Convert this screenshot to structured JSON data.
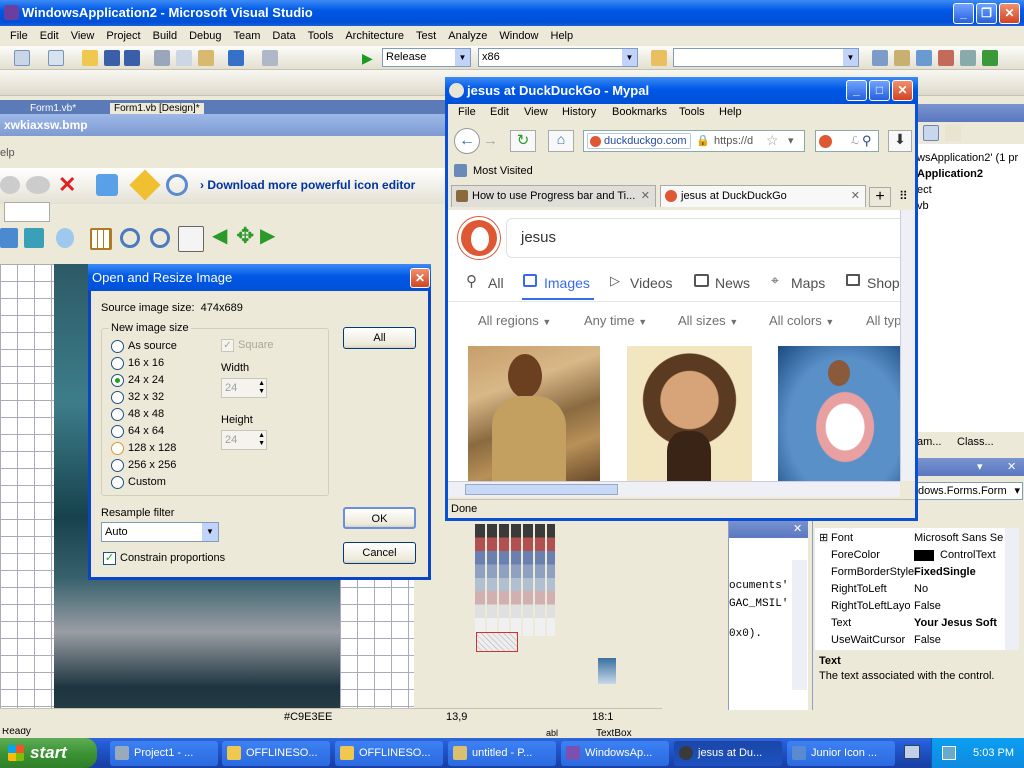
{
  "vs": {
    "title": "WindowsApplication2 - Microsoft Visual Studio",
    "menu": [
      "File",
      "Edit",
      "View",
      "Project",
      "Build",
      "Debug",
      "Team",
      "Data",
      "Tools",
      "Architecture",
      "Test",
      "Analyze",
      "Window",
      "Help"
    ],
    "config": "Release",
    "platform": "x86",
    "doc_tabs": [
      "Form1.vb*",
      "Form1.vb [Design]*"
    ],
    "status": "Ready"
  },
  "icon_editor": {
    "title": "xwkiaxsw.bmp",
    "menu_fragment": "elp",
    "download_link": "Download more powerful icon editor",
    "status": {
      "color": "#C9E3EE",
      "coord": "13,9",
      "zoom": "18:1"
    }
  },
  "dialog": {
    "title": "Open and Resize Image",
    "source_label": "Source image size:",
    "source_value": "474x689",
    "group": "New image size",
    "sizes": [
      "As source",
      "16 x 16",
      "24 x 24",
      "32 x 32",
      "48 x 48",
      "64 x 64",
      "128 x 128",
      "256 x 256",
      "Custom"
    ],
    "selected_size": "24 x 24",
    "square": "Square",
    "width_label": "Width",
    "width_value": "24",
    "height_label": "Height",
    "height_value": "24",
    "all_btn": "All",
    "resample_label": "Resample filter",
    "resample_value": "Auto",
    "constrain": "Constrain proportions",
    "ok": "OK",
    "cancel": "Cancel"
  },
  "browser": {
    "title": "jesus at DuckDuckGo - Mypal",
    "menu": [
      "File",
      "Edit",
      "View",
      "History",
      "Bookmarks",
      "Tools",
      "Help"
    ],
    "site": "duckduckgo.com",
    "url": "https://d",
    "search_placeholder": "ℒ",
    "bookmark": "Most Visited",
    "tabs": [
      "How to use Progress bar and Ti...",
      "jesus at DuckDuckGo"
    ],
    "query": "jesus",
    "nav": [
      "All",
      "Images",
      "Videos",
      "News",
      "Maps",
      "Shop"
    ],
    "filters": [
      "All regions",
      "Any time",
      "All sizes",
      "All colors",
      "All typ"
    ],
    "status": "Done"
  },
  "solution": {
    "lines": [
      "wsApplication2' (1 pr",
      "Application2",
      "ect",
      "vb"
    ],
    "tabs": [
      "am...",
      "Class..."
    ]
  },
  "code": {
    "lines": [
      "ocuments'",
      "GAC_MSIL'",
      "0x0)."
    ]
  },
  "properties": {
    "object": "dows.Forms.Form",
    "rows": [
      {
        "name": "Font",
        "value": "Microsoft Sans Se"
      },
      {
        "name": "ForeColor",
        "value": "ControlText"
      },
      {
        "name": "FormBorderStyle",
        "value": "FixedSingle"
      },
      {
        "name": "RightToLeft",
        "value": "No"
      },
      {
        "name": "RightToLeftLayo",
        "value": "False"
      },
      {
        "name": "Text",
        "value": "Your Jesus Soft"
      },
      {
        "name": "UseWaitCursor",
        "value": "False"
      }
    ],
    "desc_title": "Text",
    "desc": "The text associated with the control.",
    "fragments": [
      "abl",
      "TextBox"
    ]
  },
  "taskbar": {
    "start": "start",
    "items": [
      "Project1 - ...",
      "OFFLINESO...",
      "OFFLINESO...",
      "untitled - P...",
      "WindowsAp...",
      "jesus at Du...",
      "Junior Icon ..."
    ],
    "clock": "5:03 PM"
  }
}
